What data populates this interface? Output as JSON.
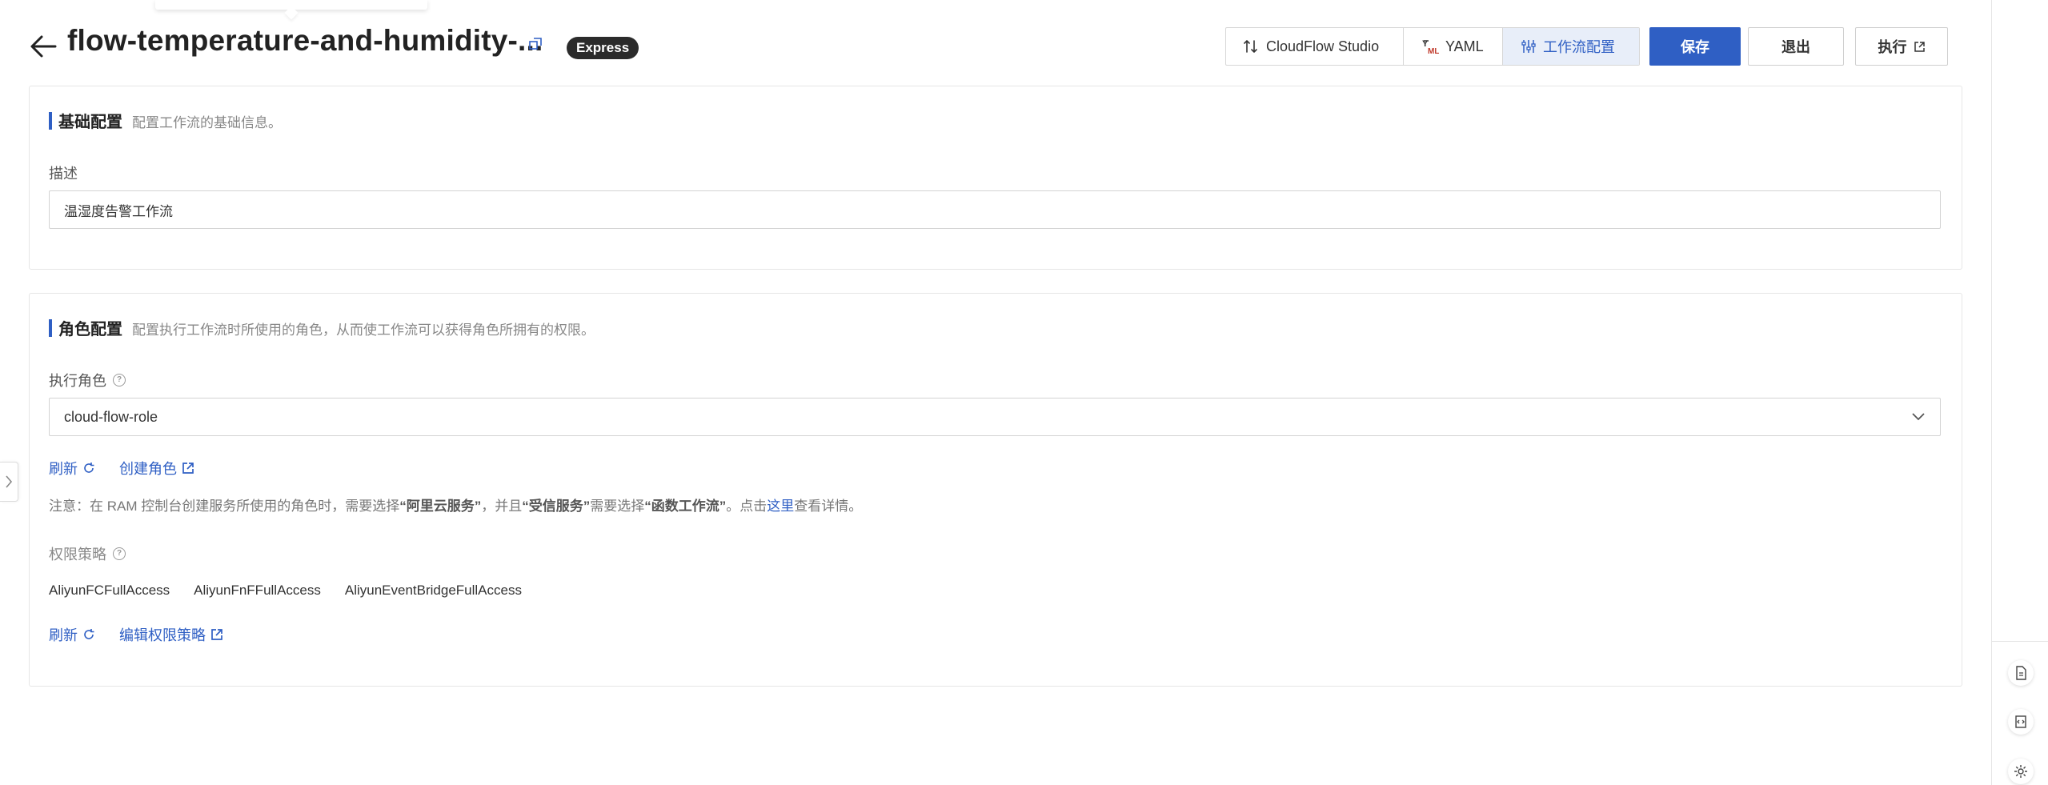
{
  "header": {
    "title": "flow-temperature-and-humidity-...",
    "badge": "Express",
    "tabs": [
      {
        "label": "CloudFlow Studio",
        "icon": "flow-icon"
      },
      {
        "label": "YAML",
        "icon": "yaml-icon"
      },
      {
        "label": "工作流配置",
        "icon": "sliders-icon",
        "active": true
      }
    ],
    "save_label": "保存",
    "exit_label": "退出",
    "execute_label": "执行"
  },
  "basic_config": {
    "title": "基础配置",
    "description": "配置工作流的基础信息。",
    "desc_label": "描述",
    "desc_value": "温湿度告警工作流"
  },
  "role_config": {
    "title": "角色配置",
    "description": "配置执行工作流时所使用的角色，从而使工作流可以获得角色所拥有的权限。",
    "role_label": "执行角色",
    "role_value": "cloud-flow-role",
    "refresh_label": "刷新",
    "create_role_label": "创建角色",
    "note": {
      "p1": "注意：在 RAM 控制台创建服务所使用的角色时，需要选择",
      "b1": "“阿里云服务”",
      "p2": "，并且",
      "b2": "“受信服务”",
      "p3": "需要选择",
      "b3": "“函数工作流”",
      "p4": "。点击",
      "link": "这里",
      "p5": "查看详情。"
    },
    "policy_label": "权限策略",
    "policies": [
      "AliyunFCFullAccess",
      "AliyunFnFFullAccess",
      "AliyunEventBridgeFullAccess"
    ],
    "refresh2_label": "刷新",
    "edit_policy_label": "编辑权限策略"
  },
  "colors": {
    "accent": "#2f5fc4",
    "badge_bg": "#2b2b2b",
    "active_tab_bg": "#e8eef9"
  }
}
